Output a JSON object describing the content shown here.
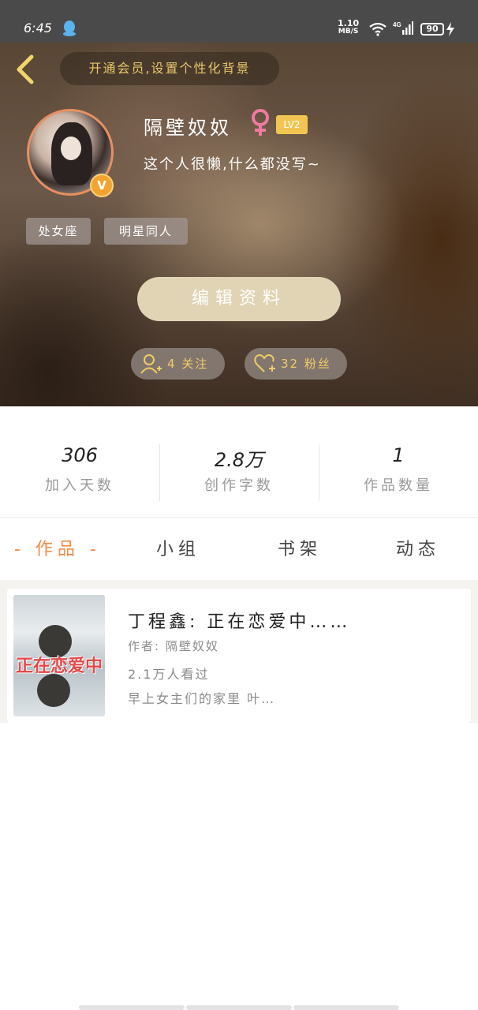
{
  "status_bar": {
    "time": "6:45",
    "speed_value": "1.10",
    "speed_unit": "MB/S",
    "battery": "90",
    "icons": [
      "qq-icon",
      "wifi-icon",
      "4g-signal-icon",
      "battery-icon",
      "charging-icon"
    ]
  },
  "profile": {
    "vip_banner": "开通会员,设置个性化背景",
    "username": "隔壁奴奴",
    "level": "LV2",
    "bio": "这个人很懒,什么都没写~",
    "tags": [
      "处女座",
      "明星同人"
    ],
    "edit_button": "编辑资料",
    "follow_label": "4 关注",
    "fans_label": "32 粉丝",
    "colors": {
      "accent_gold": "#f1cc63",
      "badge": "#f0a531"
    }
  },
  "stats": [
    {
      "value": "306",
      "label": "加入天数"
    },
    {
      "value": "2.8万",
      "label": "创作字数"
    },
    {
      "value": "1",
      "label": "作品数量"
    }
  ],
  "tabs": [
    {
      "label": "- 作品 -",
      "active": true
    },
    {
      "label": "小组",
      "active": false
    },
    {
      "label": "书架",
      "active": false
    },
    {
      "label": "动态",
      "active": false
    }
  ],
  "works": [
    {
      "cover_text": "正在恋爱中",
      "title": "丁程鑫: 正在恋爱中……",
      "author": "作者: 隔壁奴奴",
      "views": "2.1万人看过",
      "desc": "早上女主们的家里 叶…"
    }
  ],
  "colors": {
    "tab_active": "#f28b45"
  }
}
